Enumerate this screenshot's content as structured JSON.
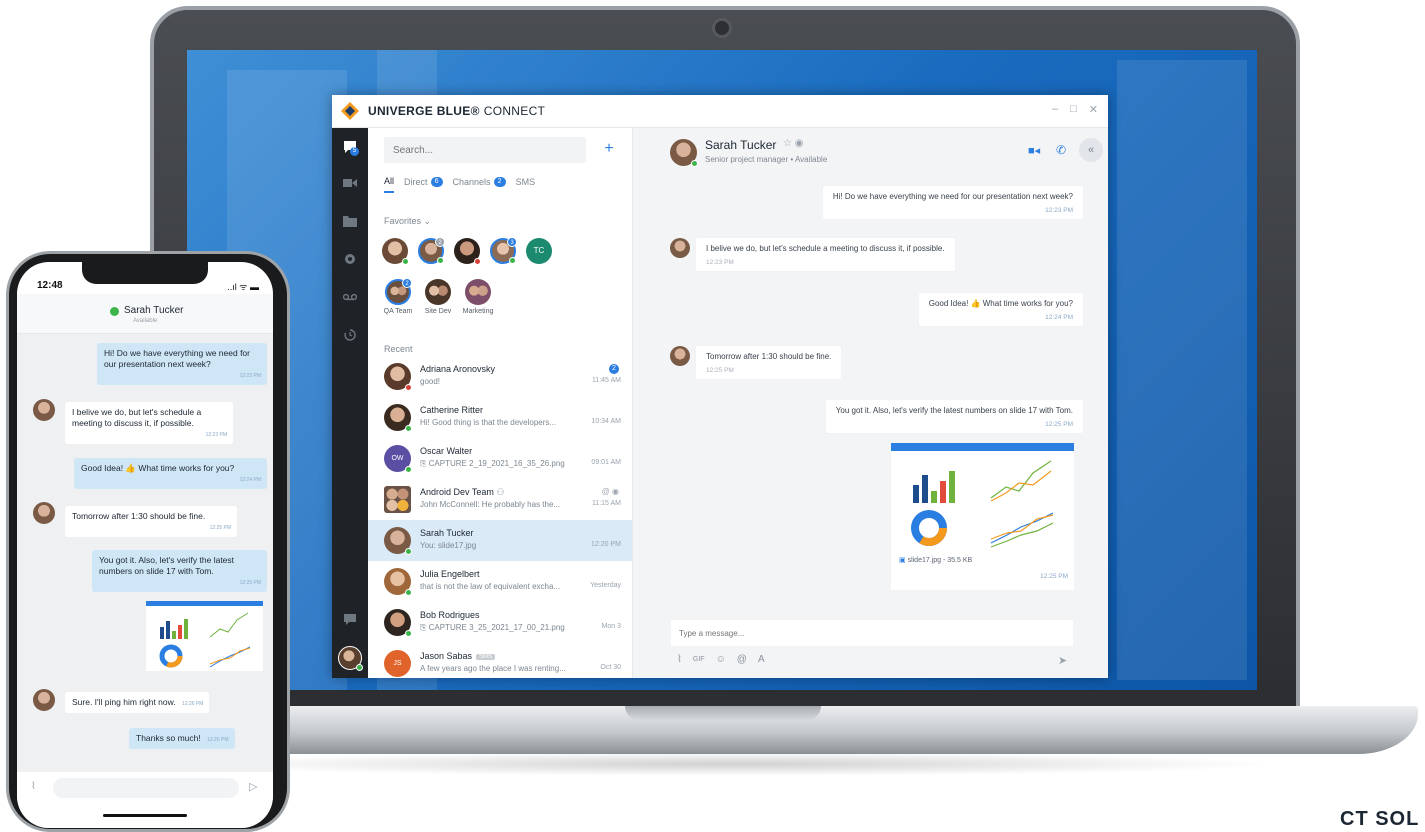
{
  "app": {
    "brand_name": "UNIVERGE BLUE®",
    "brand_sub": "CONNECT",
    "window_controls": [
      "–",
      "□",
      "✕"
    ],
    "accent_color": "#2a7de1",
    "presence_color": "#3cb44a"
  },
  "rail": {
    "items": [
      "chat-icon",
      "video-icon",
      "folder-icon",
      "record-icon",
      "voicemail-icon",
      "history-icon",
      "support-icon"
    ],
    "chat_badge": "5"
  },
  "list": {
    "search_placeholder": "Search...",
    "add_label": "+",
    "filters": [
      {
        "label": "All",
        "count": ""
      },
      {
        "label": "Direct",
        "count": "6"
      },
      {
        "label": "Channels",
        "count": "2"
      },
      {
        "label": "SMS",
        "count": ""
      }
    ],
    "favorites_label": "Favorites",
    "favorites": [
      {
        "label": "",
        "count": ""
      },
      {
        "label": "",
        "count": "2"
      },
      {
        "label": "",
        "count": ""
      },
      {
        "label": "",
        "count": "3"
      },
      {
        "label": "",
        "initials": "TC"
      }
    ],
    "groups": [
      {
        "label": "QA Team",
        "count": "2"
      },
      {
        "label": "Site Dev",
        "count": ""
      },
      {
        "label": "Marketing",
        "count": ""
      }
    ],
    "recent_label": "Recent",
    "recent": [
      {
        "name": "Adriana Aronovsky",
        "preview": "good!",
        "time": "11:45 AM",
        "unread": "2"
      },
      {
        "name": "Catherine Ritter",
        "preview": "Hi! Good thing is that the developers...",
        "time": "10:34 AM",
        "unread": ""
      },
      {
        "name": "Oscar Walter",
        "preview": "CAPTURE 2_19_2021_16_35_26.png",
        "time": "09:01 AM",
        "unread": ""
      },
      {
        "name": "Android Dev Team",
        "preview": "John McConnell: He probably has the...",
        "time": "11:15 AM",
        "unread": ""
      },
      {
        "name": "Sarah Tucker",
        "preview": "You: slide17.jpg",
        "time": "12:20 PM",
        "unread": ""
      },
      {
        "name": "Julia Engelbert",
        "preview": "that is not the law of equivalent excha...",
        "time": "Yesterday",
        "unread": ""
      },
      {
        "name": "Bob Rodrigues",
        "preview": "CAPTURE 3_25_2021_17_00_21.png",
        "time": "Mon 3",
        "unread": ""
      },
      {
        "name": "Jason Sabas",
        "preview": "A few years ago the place I was renting...",
        "time": "Oct 30",
        "unread": "",
        "tag": "SMS"
      }
    ]
  },
  "chat": {
    "contact_name": "Sarah Tucker",
    "contact_status": "Senior project manager • Available",
    "messages": [
      {
        "dir": "out",
        "text": "Hi! Do we have everything we need for our presentation next week?",
        "time": "12:23 PM"
      },
      {
        "dir": "in",
        "text": "I belive we do, but let's schedule a meeting to discuss it, if possible.",
        "time": "12:23 PM"
      },
      {
        "dir": "out",
        "text": "Good Idea! 👍 What time works for you?",
        "time": "12:24 PM"
      },
      {
        "dir": "in",
        "text": "Tomorrow after 1:30 should be fine.",
        "time": "12:25 PM"
      },
      {
        "dir": "out",
        "text": "You got it. Also, let's verify the latest numbers on slide 17 with Tom.",
        "time": "12:25 PM"
      }
    ],
    "attachment": {
      "name": "slide17.jpg - 35.5 KB",
      "time": "12:25 PM"
    },
    "composer_placeholder": "Type a message...",
    "tool_gif": "GIF"
  },
  "phone": {
    "time": "12:48",
    "status_icons": "..ıl ᯤ ▬",
    "contact_name": "Sarah Tucker",
    "contact_status": "Available",
    "messages": [
      {
        "dir": "out",
        "text": "Hi! Do we have everything we need for our presentation next week?",
        "time": "12:23 PM"
      },
      {
        "dir": "in",
        "text": "I belive we do, but let's schedule a meeting to discuss it, if possible.",
        "time": "12:23 PM"
      },
      {
        "dir": "out",
        "text": "Good Idea! 👍 What time works for you?",
        "time": "12:24 PM"
      },
      {
        "dir": "in",
        "text": "Tomorrow after 1:30 should be fine.",
        "time": "12:25 PM"
      },
      {
        "dir": "out",
        "text": "You got it. Also, let's verify the latest numbers on slide 17 with Tom.",
        "time": "12:25 PM"
      },
      {
        "dir": "in",
        "text": "Sure. I'll ping him right now.",
        "time": "12:26 PM"
      },
      {
        "dir": "out",
        "text": "Thanks so much!",
        "time": "12:26 PM"
      }
    ]
  },
  "corner_text": "CT SOL"
}
